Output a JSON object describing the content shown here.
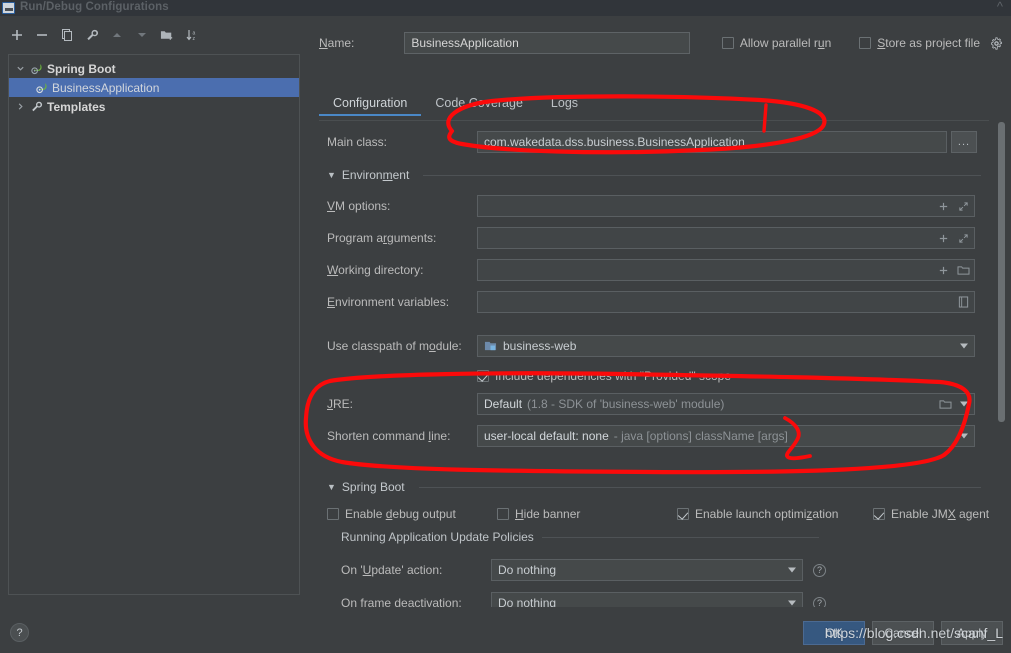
{
  "window": {
    "title": "Run/Debug Configurations",
    "icon": "run-debug-config-icon",
    "collapse_icon": "chevron-up-icon"
  },
  "left_panel": {
    "toolbar": [
      {
        "name": "add-configuration-button",
        "icon": "plus-icon"
      },
      {
        "name": "remove-configuration-button",
        "icon": "minus-icon"
      },
      {
        "name": "copy-configuration-button",
        "icon": "copy-icon"
      },
      {
        "name": "edit-templates-button",
        "icon": "wrench-icon"
      },
      {
        "name": "move-up-button",
        "icon": "arrow-up-icon"
      },
      {
        "name": "move-down-button",
        "icon": "arrow-down-icon"
      },
      {
        "name": "move-into-folder-button",
        "icon": "folder-add-icon"
      },
      {
        "name": "sort-configurations-button",
        "icon": "sort-alpha-icon"
      }
    ],
    "tree": [
      {
        "label": "Spring Boot",
        "icon": "spring-boot-icon",
        "expanded": true,
        "selected": false,
        "level": 0
      },
      {
        "label": "BusinessApplication",
        "icon": "spring-boot-icon",
        "expanded": null,
        "selected": true,
        "level": 1
      },
      {
        "label": "Templates",
        "icon": "wrench-icon",
        "expanded": false,
        "selected": false,
        "level": 0
      }
    ]
  },
  "header": {
    "name_label": "Name:",
    "name_label_mnemonic": "N",
    "name_value": "BusinessApplication",
    "allow_parallel_run": {
      "label": "Allow parallel run",
      "checked": false,
      "mnemonic": "u"
    },
    "store_as_project_file": {
      "label": "Store as project file",
      "checked": false,
      "mnemonic": "S"
    },
    "gear_icon": "gear-icon"
  },
  "tabs": [
    {
      "label": "Configuration",
      "active": true
    },
    {
      "label": "Code Coverage",
      "active": false
    },
    {
      "label": "Logs",
      "active": false
    }
  ],
  "form": {
    "main_class": {
      "label": "Main class:",
      "value": "com.wakedata.dss.business.BusinessApplication",
      "browse_button": "..."
    },
    "environment_section": {
      "label": "Environment",
      "expanded": true
    },
    "vm_options": {
      "label": "VM options:",
      "value": "",
      "icons": [
        "plus-icon",
        "expand-icon"
      ]
    },
    "program_arguments": {
      "label": "Program arguments:",
      "value": "",
      "icons": [
        "plus-icon",
        "expand-icon"
      ]
    },
    "working_directory": {
      "label": "Working directory:",
      "value": "",
      "icons": [
        "plus-icon",
        "folder-icon"
      ]
    },
    "environment_variables": {
      "label": "Environment variables:",
      "value": "",
      "icons": [
        "edit-list-icon"
      ]
    },
    "use_classpath_of_module": {
      "label": "Use classpath of module:",
      "value": "business-web",
      "icon": "module-icon"
    },
    "include_dependencies": {
      "label": "Include dependencies with \"Provided\" scope",
      "checked": true
    },
    "jre": {
      "label": "JRE:",
      "mnemonic": "J",
      "value_strong": "Default",
      "value_dim": "(1.8 - SDK of 'business-web' module)",
      "icons": [
        "folder-icon",
        "chevron-down-icon"
      ]
    },
    "shorten_command_line": {
      "label": "Shorten command line:",
      "mnemonic": "l",
      "value_strong": "user-local default: none",
      "value_dim": "- java [options] className [args]",
      "icons": [
        "chevron-down-icon"
      ]
    },
    "spring_boot_section": {
      "label": "Spring Boot",
      "expanded": true
    },
    "spring_boot_checkboxes": [
      {
        "label": "Enable debug output",
        "checked": false,
        "mnemonic": "d"
      },
      {
        "label": "Hide banner",
        "checked": false,
        "mnemonic": "H"
      },
      {
        "label": "Enable launch optimization",
        "checked": true,
        "mnemonic": "z"
      },
      {
        "label": "Enable JMX agent",
        "checked": true,
        "mnemonic": "X"
      }
    ],
    "update_policies_section": {
      "label": "Running Application Update Policies"
    },
    "on_update_action": {
      "label": "On 'Update' action:",
      "mnemonic": "U",
      "value": "Do nothing",
      "help_icon": "question-mark-icon"
    },
    "on_frame_deactivation": {
      "label": "On frame deactivation:",
      "mnemonic": "f",
      "value": "Do nothing",
      "help_icon": "question-mark-icon"
    }
  },
  "bottom": {
    "help_button": "?",
    "buttons": [
      {
        "label": "OK",
        "primary": true
      },
      {
        "label": "Cancel",
        "primary": false
      },
      {
        "label": "Apply",
        "primary": false
      }
    ],
    "watermark": "https://blog.csdn.net/scanf_L"
  },
  "annotations": {
    "color": "#fb0a0a",
    "shapes": [
      "ellipse-around-main-class-field",
      "vertical-tick-in-main-class-field",
      "large-ellipse-around-jre-and-shorten-command-line",
      "check-mark-over-shorten-command-line"
    ]
  },
  "colors": {
    "background": "#3c3f41",
    "titlebar": "#31353a",
    "selection": "#4b6eaf",
    "tab_accent": "#4a88c7",
    "field_bg": "#45494a",
    "annotation_red": "#fb0a0a",
    "primary_button": "#365880"
  }
}
